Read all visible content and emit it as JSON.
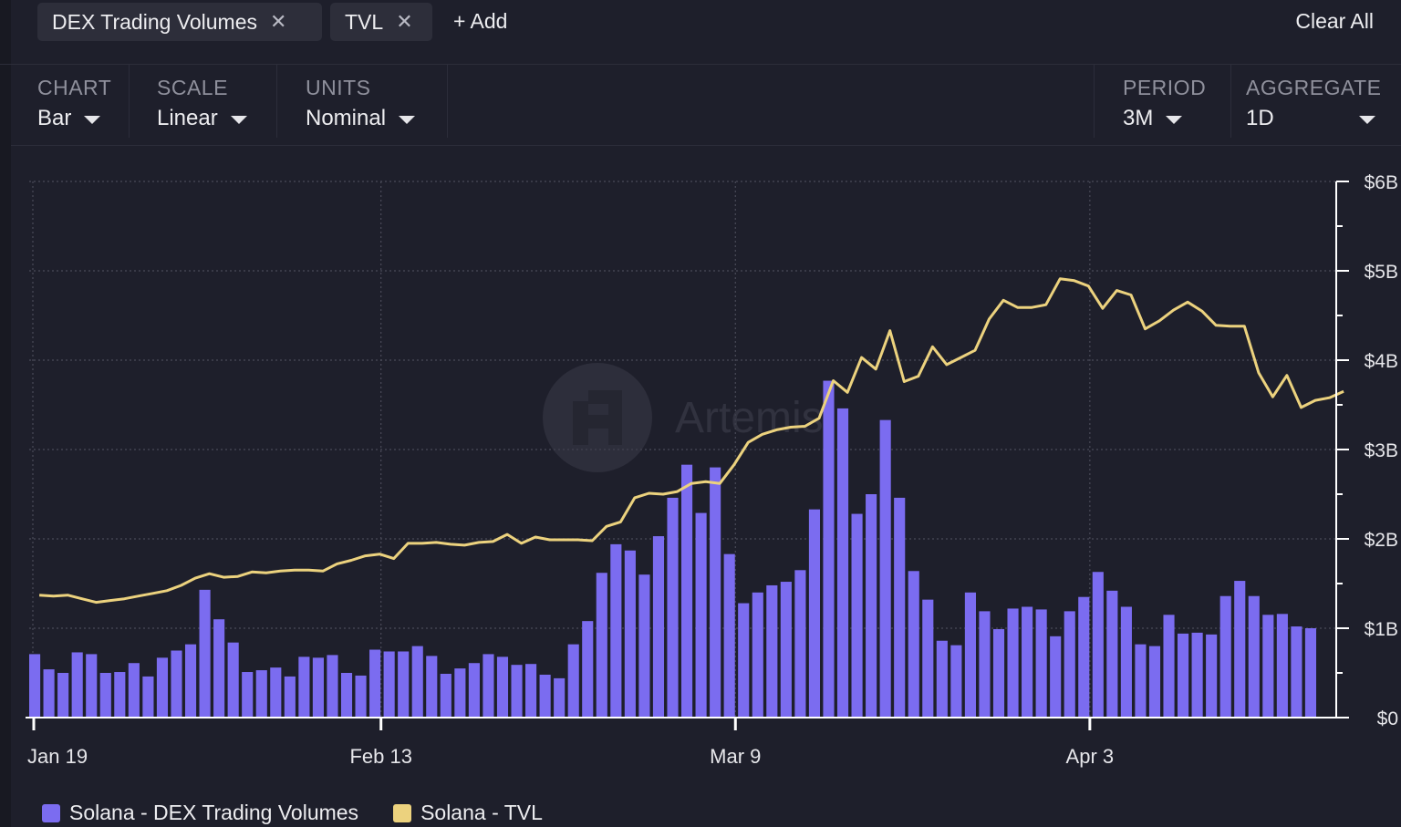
{
  "filters": {
    "tags": [
      {
        "label": "DEX Trading Volumes"
      },
      {
        "label": "TVL"
      }
    ],
    "add_label": "+ Add",
    "clear_label": "Clear All"
  },
  "controls": {
    "chart": {
      "label": "CHART",
      "value": "Bar"
    },
    "scale": {
      "label": "SCALE",
      "value": "Linear"
    },
    "units": {
      "label": "UNITS",
      "value": "Nominal"
    },
    "period": {
      "label": "PERIOD",
      "value": "3M"
    },
    "aggregate": {
      "label": "AGGREGATE",
      "value": "1D"
    }
  },
  "watermark": "Artemis",
  "colors": {
    "background": "#1e1f2b",
    "bar": "#7b6cf0",
    "line": "#ecd27e",
    "grid": "#4a4b58"
  },
  "chart_data": {
    "type": "bar",
    "x_ticks": [
      "Jan 19",
      "Feb 13",
      "Mar 9",
      "Apr 3"
    ],
    "x_tick_index": [
      0,
      25,
      50,
      75
    ],
    "ylim": [
      0,
      6
    ],
    "y_ticks": [
      "$0",
      "$1B",
      "$2B",
      "$3B",
      "$4B",
      "$5B",
      "$6B"
    ],
    "grid": true,
    "legend_position": "bottom-left",
    "series": [
      {
        "name": "Solana - DEX Trading Volumes",
        "type": "bar",
        "unit": "B USD",
        "values": [
          0.71,
          0.54,
          0.5,
          0.73,
          0.71,
          0.5,
          0.51,
          0.61,
          0.46,
          0.67,
          0.75,
          0.82,
          1.43,
          1.1,
          0.84,
          0.51,
          0.53,
          0.56,
          0.46,
          0.68,
          0.67,
          0.7,
          0.5,
          0.47,
          0.76,
          0.74,
          0.74,
          0.8,
          0.69,
          0.49,
          0.55,
          0.61,
          0.71,
          0.68,
          0.59,
          0.6,
          0.48,
          0.44,
          0.82,
          1.08,
          1.62,
          1.94,
          1.87,
          1.6,
          2.03,
          2.46,
          2.83,
          2.29,
          2.8,
          1.83,
          1.28,
          1.4,
          1.48,
          1.52,
          1.65,
          2.33,
          3.77,
          3.46,
          2.28,
          2.5,
          3.33,
          2.46,
          1.64,
          1.32,
          0.86,
          0.81,
          1.4,
          1.19,
          0.99,
          1.22,
          1.24,
          1.21,
          0.91,
          1.19,
          1.35,
          1.63,
          1.42,
          1.24,
          0.82,
          0.8,
          1.15,
          0.94,
          0.95,
          0.93,
          1.36,
          1.53,
          1.36,
          1.15,
          1.16,
          1.02,
          1.0
        ]
      },
      {
        "name": "Solana - TVL",
        "type": "line",
        "unit": "B USD",
        "values": [
          1.37,
          1.36,
          1.37,
          1.33,
          1.29,
          1.31,
          1.33,
          1.36,
          1.39,
          1.42,
          1.48,
          1.56,
          1.61,
          1.57,
          1.58,
          1.63,
          1.62,
          1.64,
          1.65,
          1.65,
          1.64,
          1.72,
          1.76,
          1.81,
          1.83,
          1.78,
          1.95,
          1.95,
          1.96,
          1.94,
          1.93,
          1.96,
          1.97,
          2.05,
          1.95,
          2.02,
          1.99,
          1.99,
          1.99,
          1.98,
          2.14,
          2.19,
          2.46,
          2.51,
          2.5,
          2.53,
          2.62,
          2.64,
          2.62,
          2.83,
          3.08,
          3.17,
          3.22,
          3.25,
          3.26,
          3.35,
          3.77,
          3.64,
          4.03,
          3.9,
          4.33,
          3.76,
          3.82,
          4.15,
          3.95,
          4.03,
          4.11,
          4.46,
          4.67,
          4.59,
          4.59,
          4.62,
          4.91,
          4.89,
          4.83,
          4.58,
          4.78,
          4.73,
          4.35,
          4.44,
          4.56,
          4.65,
          4.55,
          4.39,
          4.38,
          4.38,
          3.86,
          3.59,
          3.83,
          3.47,
          3.55,
          3.58,
          3.65
        ]
      }
    ]
  }
}
